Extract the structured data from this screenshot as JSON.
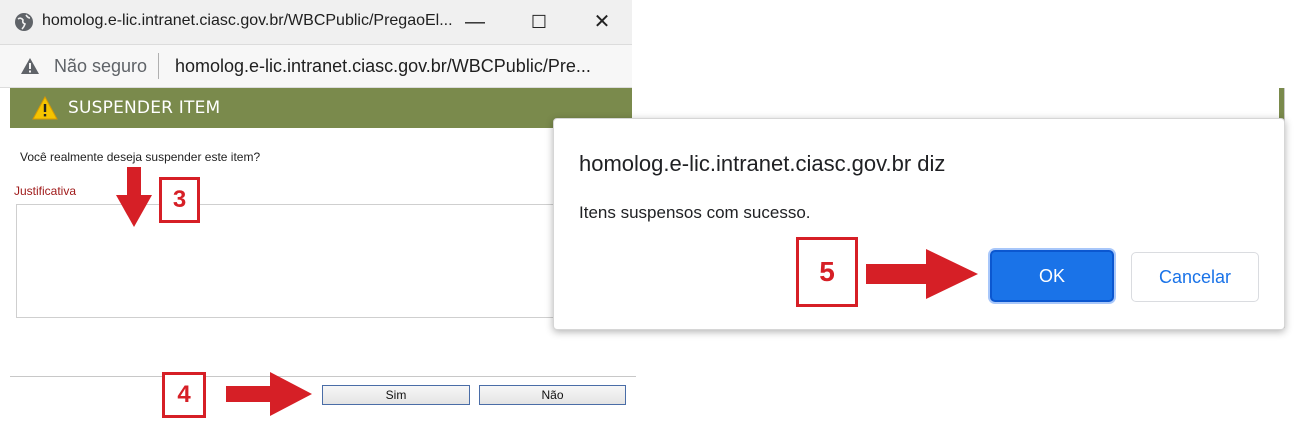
{
  "window": {
    "title": "homolog.e-lic.intranet.ciasc.gov.br/WBCPublic/PregaoEl...",
    "minimize_glyph": "—",
    "maximize_glyph": "☐",
    "close_glyph": "✕"
  },
  "address_bar": {
    "security_label": "Não seguro",
    "url": "homolog.e-lic.intranet.ciasc.gov.br/WBCPublic/Pre..."
  },
  "section": {
    "title": "SUSPENDER ITEM",
    "icon": "warning-icon"
  },
  "form": {
    "question": "Você realmente deseja suspender este item?",
    "justification_label": "Justificativa",
    "justification_value": "",
    "yes_label": "Sim",
    "no_label": "Não"
  },
  "annotations": {
    "step3": "3",
    "step4": "4",
    "step5": "5",
    "color": "#d61f26"
  },
  "alert": {
    "origin": "homolog.e-lic.intranet.ciasc.gov.br diz",
    "message": "Itens suspensos com sucesso.",
    "ok_label": "OK",
    "cancel_label": "Cancelar"
  },
  "colors": {
    "section_bar": "#7a8a4c",
    "ok_button": "#1a73e8",
    "label_red": "#a01b1b"
  }
}
